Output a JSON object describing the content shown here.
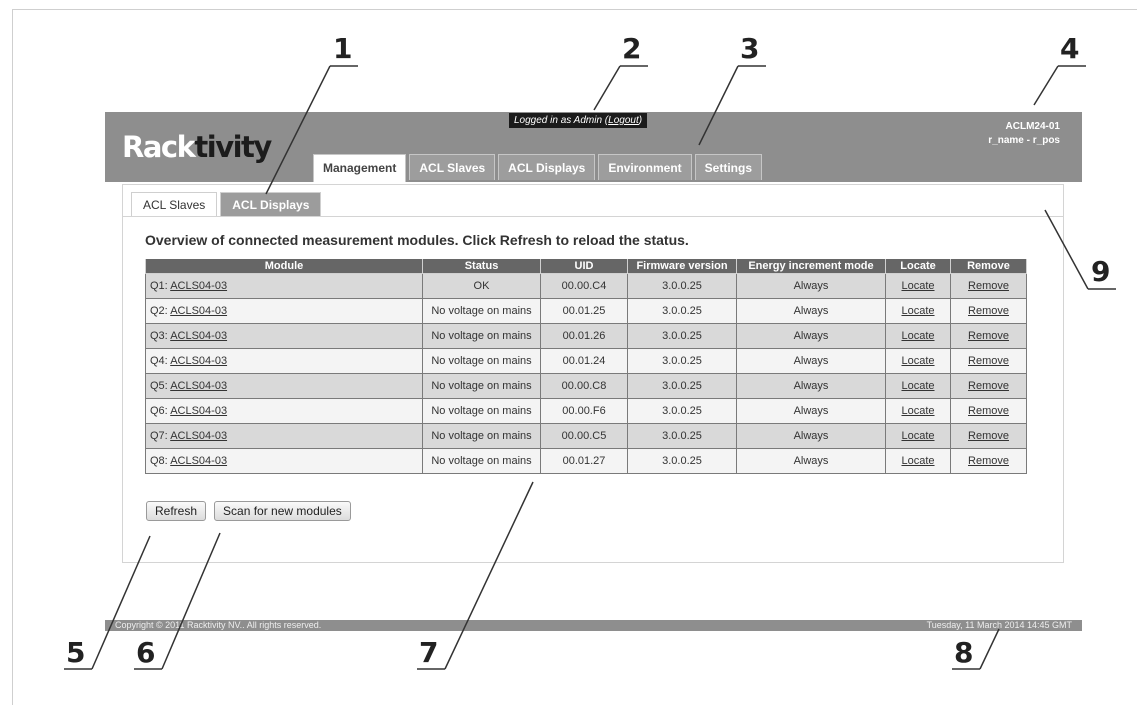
{
  "header": {
    "logo_part1": "Rack",
    "logo_part2": "tivity",
    "login_prefix": "Logged in as  Admin  (",
    "logout_label": "Logout",
    "login_suffix": ")",
    "device_name": "ACLM24-01",
    "device_location": "r_name - r_pos"
  },
  "main_tabs": [
    "Management",
    "ACL Slaves",
    "ACL Displays",
    "Environment",
    "Settings"
  ],
  "sub_tabs": [
    "ACL Slaves",
    "ACL Displays"
  ],
  "overview_text": "Overview of connected measurement modules. Click Refresh to reload the status.",
  "table": {
    "headers": [
      "Module",
      "Status",
      "UID",
      "Firmware version",
      "Energy increment mode",
      "Locate",
      "Remove"
    ],
    "rows": [
      {
        "slot": "Q1:",
        "module": "ACLS04-03",
        "status": "OK",
        "uid": "00.00.C4",
        "firmware": "3.0.0.25",
        "mode": "Always",
        "locate": "Locate",
        "remove": "Remove"
      },
      {
        "slot": "Q2:",
        "module": "ACLS04-03",
        "status": "No voltage on mains",
        "uid": "00.01.25",
        "firmware": "3.0.0.25",
        "mode": "Always",
        "locate": "Locate",
        "remove": "Remove"
      },
      {
        "slot": "Q3:",
        "module": "ACLS04-03",
        "status": "No voltage on mains",
        "uid": "00.01.26",
        "firmware": "3.0.0.25",
        "mode": "Always",
        "locate": "Locate",
        "remove": "Remove"
      },
      {
        "slot": "Q4:",
        "module": "ACLS04-03",
        "status": "No voltage on mains",
        "uid": "00.01.24",
        "firmware": "3.0.0.25",
        "mode": "Always",
        "locate": "Locate",
        "remove": "Remove"
      },
      {
        "slot": "Q5:",
        "module": "ACLS04-03",
        "status": "No voltage on mains",
        "uid": "00.00.C8",
        "firmware": "3.0.0.25",
        "mode": "Always",
        "locate": "Locate",
        "remove": "Remove"
      },
      {
        "slot": "Q6:",
        "module": "ACLS04-03",
        "status": "No voltage on mains",
        "uid": "00.00.F6",
        "firmware": "3.0.0.25",
        "mode": "Always",
        "locate": "Locate",
        "remove": "Remove"
      },
      {
        "slot": "Q7:",
        "module": "ACLS04-03",
        "status": "No voltage on mains",
        "uid": "00.00.C5",
        "firmware": "3.0.0.25",
        "mode": "Always",
        "locate": "Locate",
        "remove": "Remove"
      },
      {
        "slot": "Q8:",
        "module": "ACLS04-03",
        "status": "No voltage on mains",
        "uid": "00.01.27",
        "firmware": "3.0.0.25",
        "mode": "Always",
        "locate": "Locate",
        "remove": "Remove"
      }
    ]
  },
  "buttons": {
    "refresh": "Refresh",
    "scan": "Scan for new modules"
  },
  "footer": {
    "copyright": "Copyright © 2011 Racktivity NV.. All rights reserved.",
    "datetime": "Tuesday, 11 March 2014 14:45 GMT"
  },
  "callouts": [
    "1",
    "2",
    "3",
    "4",
    "5",
    "6",
    "7",
    "8",
    "9"
  ]
}
